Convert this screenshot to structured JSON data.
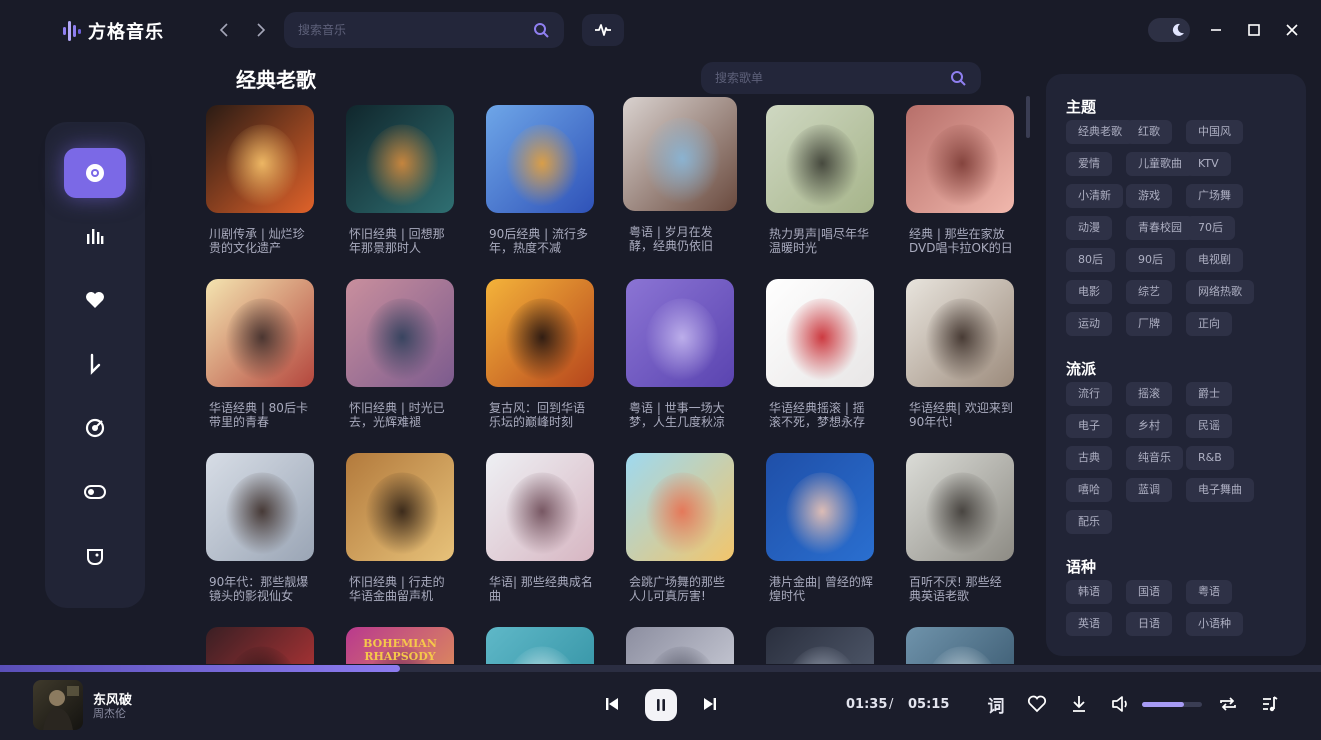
{
  "app": {
    "name": "方格音乐"
  },
  "header": {
    "search_placeholder": "搜索音乐"
  },
  "main": {
    "title": "经典老歌",
    "search_placeholder": "搜索歌单",
    "playlists": [
      {
        "title": "川剧传承 | 灿烂珍贵的文化遗产",
        "colors": [
          "#2a1b14",
          "#e0622a",
          "#f7c36b"
        ]
      },
      {
        "title": "怀旧经典 | 回想那年那景那时人",
        "colors": [
          "#10262c",
          "#2f6f72",
          "#d78b3c"
        ]
      },
      {
        "title": "90后经典 | 流行多年，热度不减",
        "colors": [
          "#6ea6e8",
          "#2f52b8",
          "#e8a23a"
        ]
      },
      {
        "title": "粤语 | 岁月在发酵，经典仍依旧",
        "colors": [
          "#d9d2cf",
          "#6a4a3e",
          "#89b7d9"
        ]
      },
      {
        "title": "热力男声|唱尽年华温暖时光",
        "colors": [
          "#cfd8c2",
          "#a6b48a",
          "#3a3c33"
        ]
      },
      {
        "title": "经典 | 那些在家放DVD唱卡拉OK的日子",
        "colors": [
          "#b76f6a",
          "#f1b8ad",
          "#7c3b35"
        ]
      },
      {
        "title": "华语经典 | 80后卡带里的青春",
        "colors": [
          "#f4e4b0",
          "#b4463d",
          "#3c2c2a"
        ]
      },
      {
        "title": "怀旧经典 | 时光已去，光辉难褪",
        "colors": [
          "#c98f9d",
          "#7c5b8e",
          "#2d3f5a"
        ]
      },
      {
        "title": "复古风：回到华语乐坛的巅峰时刻",
        "colors": [
          "#f4b33a",
          "#b6451c",
          "#1f1310"
        ]
      },
      {
        "title": "粤语 | 世事一场大梦，人生几度秋凉",
        "colors": [
          "#8b74d4",
          "#5a44b0",
          "#c4b7ef"
        ]
      },
      {
        "title": "华语经典摇滚 | 摇滚不死，梦想永存",
        "colors": [
          "#ffffff",
          "#e8e6e6",
          "#c8262d"
        ]
      },
      {
        "title": "华语经典| 欢迎来到 90年代!",
        "colors": [
          "#e8e4dd",
          "#9c8b7c",
          "#3b2e28"
        ]
      },
      {
        "title": "90年代：那些靓爆镜头的影视仙女",
        "colors": [
          "#d7dde6",
          "#9aa5b5",
          "#3a2b26"
        ]
      },
      {
        "title": "怀旧经典 | 行走的华语金曲留声机",
        "colors": [
          "#b37a3c",
          "#e7c27a",
          "#2c1e14"
        ]
      },
      {
        "title": "华语| 那些经典成名曲",
        "colors": [
          "#eef0f4",
          "#d7b6c2",
          "#6c4a56"
        ]
      },
      {
        "title": "会跳广场舞的那些人儿可真厉害!",
        "colors": [
          "#9ed9f0",
          "#f2c56b",
          "#e76f51"
        ]
      },
      {
        "title": "港片金曲| 曾经的辉煌时代",
        "colors": [
          "#1f4fa8",
          "#2a6fd0",
          "#f0c6b4"
        ]
      },
      {
        "title": "百听不厌! 那些经典英语老歌",
        "colors": [
          "#dbdcd7",
          "#8d8b84",
          "#3d3935"
        ]
      },
      {
        "title": "",
        "colors": [
          "#3a1f24",
          "#d23a3a",
          "#1a1012"
        ]
      },
      {
        "title": "",
        "colors": [
          "#b9398e",
          "#e9a84a",
          "#5a1d55"
        ],
        "cover_text": "BOHEMIAN RHAPSODY"
      },
      {
        "title": "",
        "colors": [
          "#5fb8c8",
          "#2a8a9c",
          "#dff1f4"
        ]
      },
      {
        "title": "",
        "colors": [
          "#8c8ea0",
          "#d9dbe4",
          "#3b3d4e"
        ]
      },
      {
        "title": "",
        "colors": [
          "#2a2f3e",
          "#5b6578",
          "#a8b0bf"
        ]
      },
      {
        "title": "",
        "colors": [
          "#6f93ab",
          "#2f4d63",
          "#d7e3ea"
        ]
      }
    ]
  },
  "tags": {
    "sections": [
      {
        "title": "主题",
        "items": [
          "经典老歌",
          "红歌",
          "中国风",
          "爱情",
          "儿童歌曲",
          "KTV",
          "小清新",
          "游戏",
          "广场舞",
          "动漫",
          "青春校园",
          "70后",
          "80后",
          "90后",
          "电视剧",
          "电影",
          "综艺",
          "网络热歌",
          "运动",
          "厂牌",
          "正向"
        ]
      },
      {
        "title": "流派",
        "items": [
          "流行",
          "摇滚",
          "爵士",
          "电子",
          "乡村",
          "民谣",
          "古典",
          "纯音乐",
          "R&B",
          "嘻哈",
          "蓝调",
          "电子舞曲",
          "配乐"
        ]
      },
      {
        "title": "语种",
        "items": [
          "韩语",
          "国语",
          "粤语",
          "英语",
          "日语",
          "小语种"
        ]
      }
    ]
  },
  "player": {
    "song": "东风破",
    "artist": "周杰伦",
    "current_time": "01:35",
    "separator": "/",
    "total_time": "05:15",
    "lyric_label": "词",
    "progress": 0.3,
    "volume": 0.7
  },
  "colors": {
    "accent": "#7b69e6",
    "background": "#191b28",
    "panel": "#212436"
  }
}
